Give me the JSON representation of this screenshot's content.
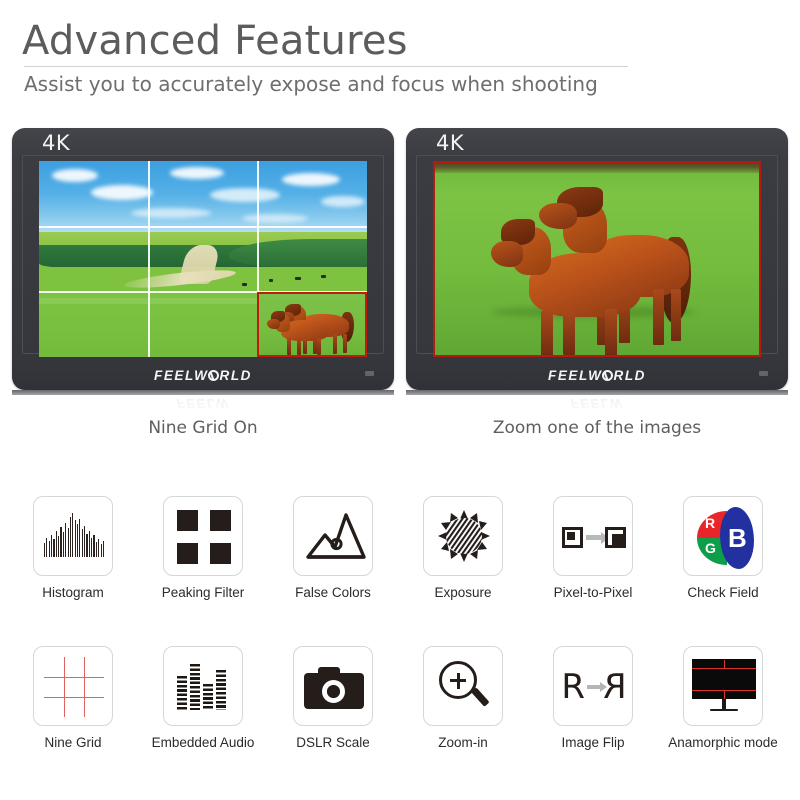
{
  "header": {
    "title": "Advanced Features",
    "subtitle": "Assist you to accurately expose and focus when shooting"
  },
  "monitors": [
    {
      "badge": "4K",
      "brand_prefix": "FEELW",
      "brand_suffix": "RLD",
      "caption": "Nine Grid On",
      "mode": "nine-grid",
      "grid_lines": 4,
      "highlight_cell": "bottom-right",
      "highlight_color": "#c21a12"
    },
    {
      "badge": "4K",
      "brand_prefix": "FEELW",
      "brand_suffix": "RLD",
      "caption": "Zoom one of the images",
      "mode": "zoomed",
      "frame_color": "#b51a12"
    }
  ],
  "features": {
    "row1": [
      {
        "label": "Histogram",
        "icon": "histogram-icon"
      },
      {
        "label": "Peaking Filter",
        "icon": "peaking-filter-icon"
      },
      {
        "label": "False Colors",
        "icon": "false-colors-icon"
      },
      {
        "label": "Exposure",
        "icon": "exposure-sun-icon"
      },
      {
        "label": "Pixel-to-Pixel",
        "icon": "pixel-to-pixel-icon"
      },
      {
        "label": "Check Field",
        "icon": "check-field-icon"
      }
    ],
    "row2": [
      {
        "label": "Nine Grid",
        "icon": "nine-grid-icon"
      },
      {
        "label": "Embedded  Audio",
        "icon": "embedded-audio-icon"
      },
      {
        "label": "DSLR Scale",
        "icon": "dslr-camera-icon"
      },
      {
        "label": "Zoom-in",
        "icon": "magnifier-plus-icon"
      },
      {
        "label": "Image Flip",
        "icon": "image-flip-icon"
      },
      {
        "label": "Anamorphic  mode",
        "icon": "anamorphic-monitor-icon"
      }
    ]
  },
  "check_field": {
    "r": "R",
    "g": "G",
    "b": "B",
    "red": "#e8262a",
    "green": "#0e9e4a",
    "blue": "#2330a0"
  },
  "image_flip": {
    "left_char": "R",
    "right_char": "R"
  },
  "colors": {
    "title": "#5c5c5c",
    "subtitle": "#6e6e6e",
    "caption": "#5e5e5e",
    "bezel": "#393b41",
    "tile_border": "#d6d6d6",
    "grid_red": "#e0625c"
  }
}
